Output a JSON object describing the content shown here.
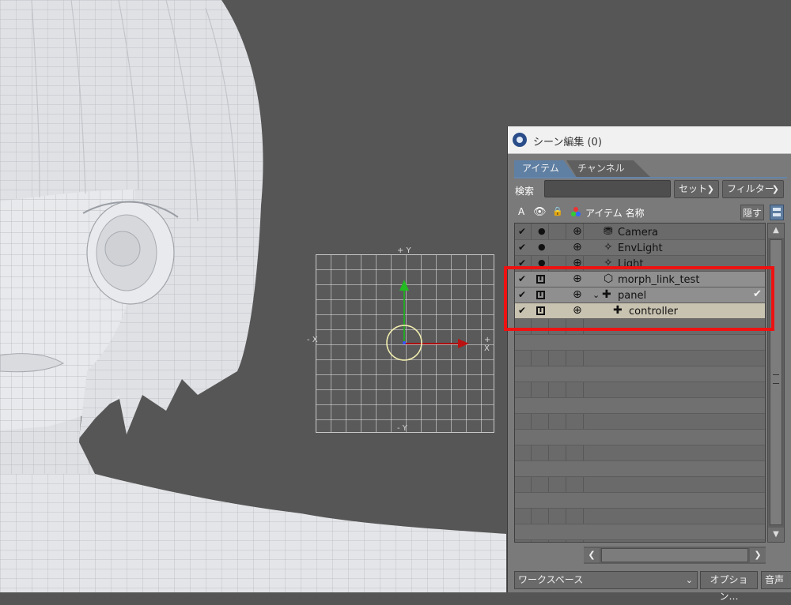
{
  "viewport": {
    "axis_labels": {
      "plus_y": "+ Y",
      "minus_y": "- Y",
      "minus_x": "- X",
      "plus_x": "+ X"
    }
  },
  "scene_editor": {
    "title": "シーン編集 (0)",
    "tabs": [
      "アイテム",
      "チャンネル"
    ],
    "search_label": "検索",
    "search_value": "",
    "set_label": "セット",
    "filter_label": "フィルター",
    "columns": {
      "active": "A",
      "items_name": "アイテム 名称"
    },
    "hide_button": "隠す",
    "rows": [
      {
        "name": "Camera",
        "icon": "camera-icon"
      },
      {
        "name": "EnvLight",
        "icon": "light-icon"
      },
      {
        "name": "Light",
        "icon": "light-icon"
      },
      {
        "name": "morph_link_test",
        "icon": "mesh-icon"
      },
      {
        "name": "panel",
        "icon": "null-icon",
        "expanded": true
      },
      {
        "name": "controller",
        "icon": "null-icon"
      }
    ],
    "workspace_label": "ワークスペース",
    "options_label": "オプション…",
    "audio_label": "音声"
  }
}
